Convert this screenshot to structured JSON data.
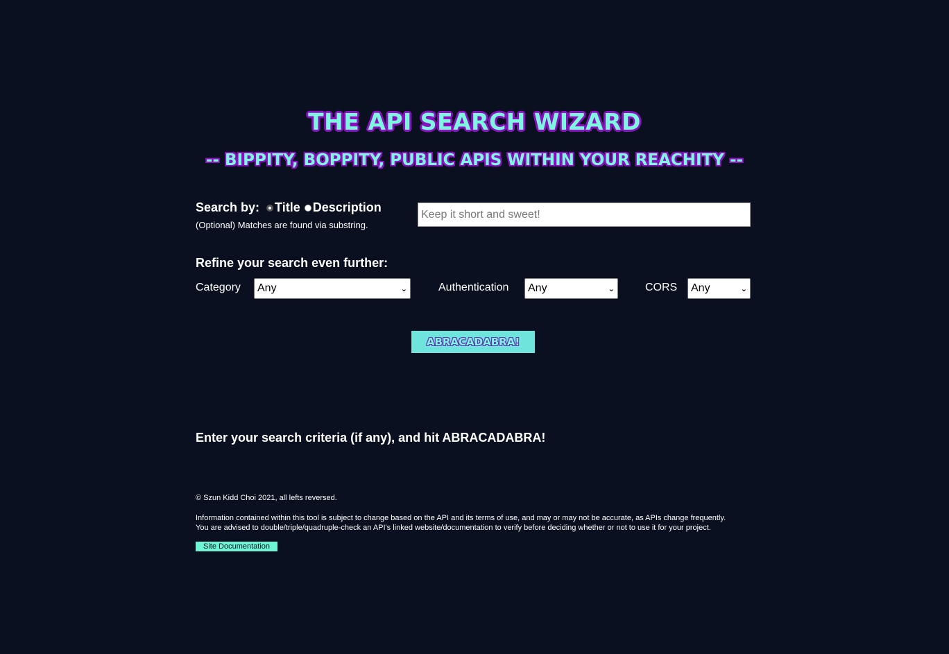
{
  "header": {
    "title": "THE API SEARCH WIZARD",
    "subtitle": "-- BIPPITY, BOPPITY, PUBLIC APIS WITHIN YOUR REACHITY --"
  },
  "search": {
    "label": "Search by:",
    "options": [
      "Title",
      "Description"
    ],
    "selected": "Title",
    "hint": "(Optional) Matches are found via substring.",
    "placeholder": "Keep it short and sweet!",
    "value": ""
  },
  "refine": {
    "heading": "Refine your search even further:",
    "category": {
      "label": "Category",
      "value": "Any"
    },
    "authentication": {
      "label": "Authentication",
      "value": "Any"
    },
    "cors": {
      "label": "CORS",
      "value": "Any"
    }
  },
  "button": {
    "label": "ABRACADABRA!"
  },
  "results": {
    "message": "Enter your search criteria (if any), and hit ABRACADABRA!"
  },
  "footer": {
    "copyright": "© Szun Kidd Choi 2021, all lefts reversed.",
    "disclaimer_line1": "Information contained within this tool is subject to change based on the API and its terms of use, and may or may not be accurate, as APIs change frequently.",
    "disclaimer_line2": "You are advised to double/triple/quadruple-check an API's linked website/documentation to verify before deciding whether or not to use it for your project.",
    "doc_link": "Site Documentation"
  },
  "colors": {
    "background": "#0a1020",
    "accent": "#7df5df",
    "outline": "#8a10c0",
    "button": "#6ee4dd"
  }
}
